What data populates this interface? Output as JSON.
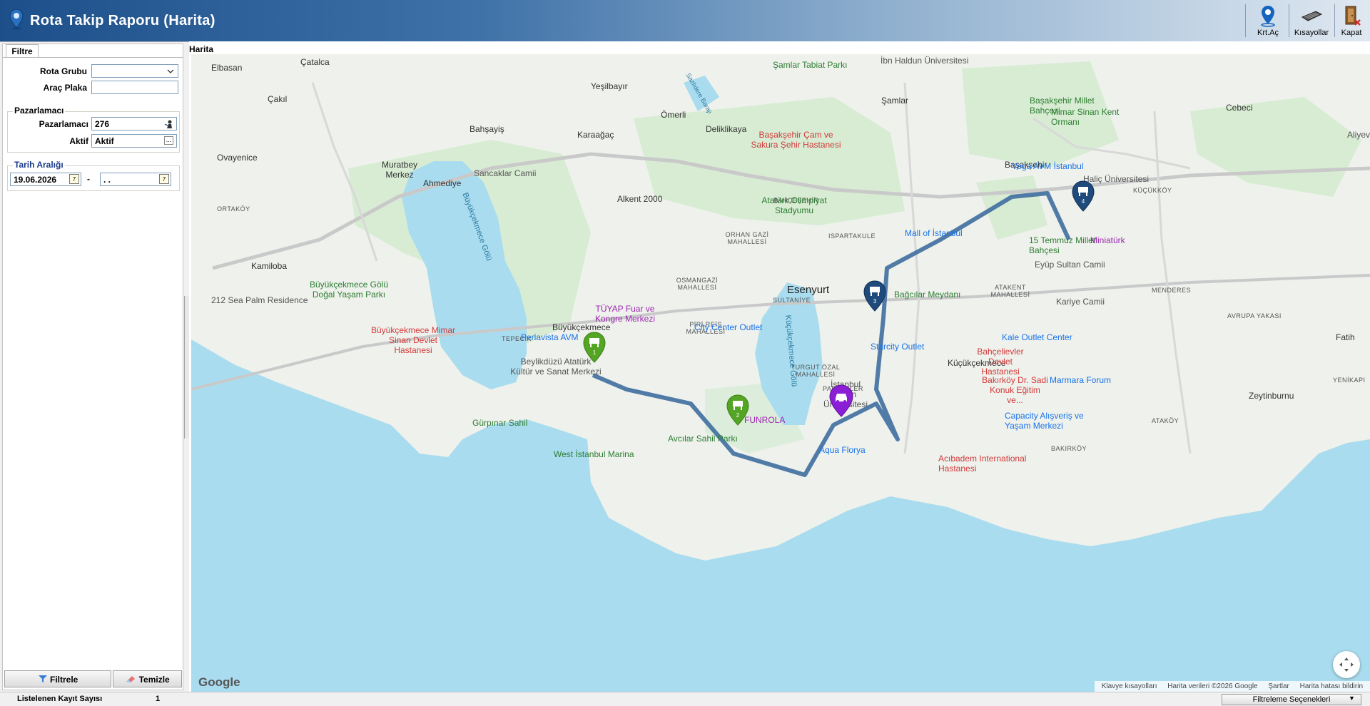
{
  "window": {
    "title": "Rota Takip Raporu (Harita)",
    "toolbar": [
      {
        "label": "Krt.Aç",
        "icon": "map-pin-icon"
      },
      {
        "label": "Kısayollar",
        "icon": "keyboard-icon"
      },
      {
        "label": "Kapat",
        "icon": "exit-door-icon"
      }
    ]
  },
  "filter_panel": {
    "tab": "Filtre",
    "rota_grubu_label": "Rota Grubu",
    "rota_grubu_value": "",
    "arac_plaka_label": "Araç Plaka",
    "arac_plaka_value": "",
    "pazarlamaci_group": "Pazarlamacı",
    "pazarlamaci_label": "Pazarlamacı",
    "pazarlamaci_value": "276",
    "aktif_label": "Aktif",
    "aktif_value": "Aktif",
    "tarih_group": "Tarih Aralığı",
    "date_from": "19.06.2026",
    "date_sep": "-",
    "date_to": ". .",
    "cal_glyph": "7",
    "filtrele": "Filtrele",
    "temizle": "Temizle"
  },
  "map": {
    "header": "Harita",
    "google": "Google",
    "attribution": [
      "Klavye kısayolları",
      "Harita verileri ©2026 Google",
      "Şartlar",
      "Harita hatası bildirin"
    ],
    "labels": {
      "l0": "Elbasan",
      "l1": "Çatalca",
      "l2": "Çakıl",
      "l3": "Yeşilbayır",
      "l4": "Ömerli",
      "l5": "Deliklikaya",
      "l6": "Şamlar",
      "l7": "Bahşayiş",
      "l8": "Karaağaç",
      "l9": "Ovayenice",
      "l10": "Muratbey Merkez",
      "l11": "Ahmediye",
      "l12": "Alkent 2000",
      "l13": "Başakşehir",
      "l14": "Cebeci",
      "l15": "Kamiloba",
      "l16": "Esenyurt",
      "l17": "Büyükçekmece",
      "l18": "Küçükçekmece",
      "l19": "Fatih",
      "l20": "Zeytinburnu",
      "s0": "ORTAKÖY",
      "s1": "BAHÇEŞEHİR",
      "s2": "ORHAN GAZİ MAHALLESİ",
      "s3": "ISPARTAKULE",
      "s4": "OSMANGAZİ MAHALLESİ",
      "s5": "SULTANİYE",
      "s6": "PİRİ REİS MAHALLESİ",
      "s7": "TEPECİK",
      "s8": "TURGUT ÖZAL MAHALLESİ",
      "s9": "PARSELLER",
      "s10": "ATAKENT MAHALLESİ",
      "s11": "MENDERES",
      "s12": "AVRUPA YAKASI",
      "s13": "KÜÇÜKKÖY",
      "s14": "ATAKÖY",
      "s15": "BAKIRKÖY",
      "s16": "YENİKAPI",
      "p0": "Şamlar Tabiat Parkı",
      "p1": "İbn Haldun Üniversitesi",
      "p2": "Başakşehir Millet Bahçesi",
      "p3": "Başakşehir Çam ve Sakura Şehir Hastanesi",
      "p4": "Sancaklar Camii",
      "p5": "Atatürk Olimpiyat Stadyumu",
      "p6": "Mall of İstanbul",
      "p7": "Vega AVM İstanbul",
      "p8": "Mimar Sinan Kent Ormanı",
      "p9": "Haliç Üniversitesi",
      "p10": "15 Temmuz Millet Bahçesi",
      "p11": "Miniatürk",
      "p12": "Eyüp Sultan Camii",
      "p13": "Kariye Camii",
      "p14": "Büyükçekmece Gölü Doğal Yaşam Parkı",
      "p15": "212 Sea Palm Residence",
      "p16": "Büyükçekmece Mimar Sinan Devlet Hastanesi",
      "p17": "TÜYAP Fuar ve Kongre Merkezi",
      "p18": "Perlavista AVM",
      "p19": "Beylikdüzü Atatürk Kültür ve Sanat Merkezi",
      "p20": "City Center Outlet",
      "p21": "Bağcılar Meydanı",
      "p22": "Starcity Outlet",
      "p23": "Kale Outlet Center",
      "p24": "Bahçelievler Devlet Hastanesi",
      "p25": "Bakırköy Dr. Sadi Konuk Eğitim ve...",
      "p26": "Marmara Forum",
      "p27": "İstanbul Aydın Üniversitesi",
      "p28": "FUNROLA",
      "p29": "Avcılar Sahil Parkı",
      "p30": "Gürpınar Sahil",
      "p31": "West İstanbul Marina",
      "p32": "Aqua Florya",
      "p33": "Capacity Alışveriş ve Yaşam Merkezi",
      "p34": "Acıbadem International Hastanesi",
      "p35": "Aliyev",
      "lake1": "Büyükçekmece Gölü",
      "lake2": "Küçükçekmece Gölü",
      "road1": "Sazlıdere Barajı"
    },
    "markers": [
      {
        "label": "1",
        "color": "#54a523"
      },
      {
        "label": "2",
        "color": "#54a523"
      },
      {
        "label": "3",
        "color": "#1f4a7c"
      },
      {
        "label": "4",
        "color": "#1f4a7c"
      },
      {
        "label": "",
        "color": "#8b1fd6"
      }
    ]
  },
  "status": {
    "label": "Listelenen Kayıt Sayısı",
    "count": "1",
    "filter_options": "Filtreleme Seçenekleri"
  }
}
